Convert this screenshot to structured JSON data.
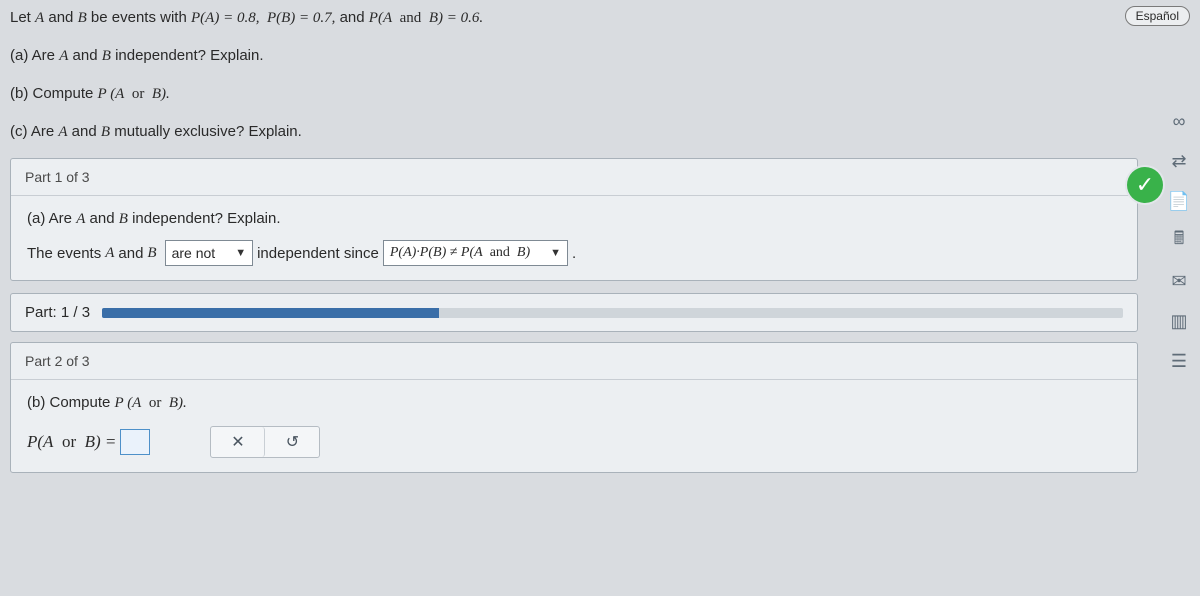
{
  "lang_button": "Español",
  "prompt": {
    "intro_a": "Let ",
    "A": "A",
    "and1": " and ",
    "B": "B",
    "intro_b": " be events with ",
    "pA": "P(A) = 0.8,  P(B) = 0.7,",
    "and2": "  and ",
    "pAB": "P(A  and  B) = 0.6."
  },
  "qa": {
    "label": "(a) Are ",
    "mid": " and ",
    "tail": " independent? Explain."
  },
  "qb": {
    "label": "(b) Compute ",
    "expr": "P (A  or  B)."
  },
  "qc": {
    "label": "(c) Are ",
    "mid": " and ",
    "tail": " mutually exclusive? Explain."
  },
  "part1": {
    "header": "Part 1 of 3",
    "q": {
      "pre": "(a) Are ",
      "mid": " and ",
      "post": " independent? Explain."
    },
    "sentence": {
      "pre": "The events ",
      "mid": " and ",
      "post": " "
    },
    "dd1": "are not",
    "between": " independent since ",
    "dd2": "P(A)·P(B) ≠ P(A  and  B)",
    "period": "."
  },
  "progress": {
    "label": "Part: 1 / 3",
    "pct": 33
  },
  "part2": {
    "header": "Part 2 of 3",
    "q": {
      "pre": "(b) Compute ",
      "expr": "P (A  or  B)."
    },
    "lhs": "P(A  or  B) = "
  },
  "icons": {
    "loop": "∞",
    "shuffle": "⇄",
    "doc": "📄",
    "calc": "🖩",
    "mail": "✉",
    "bars": "▥",
    "list": "☰",
    "close": "✕",
    "undo": "↺",
    "check": "✓"
  }
}
